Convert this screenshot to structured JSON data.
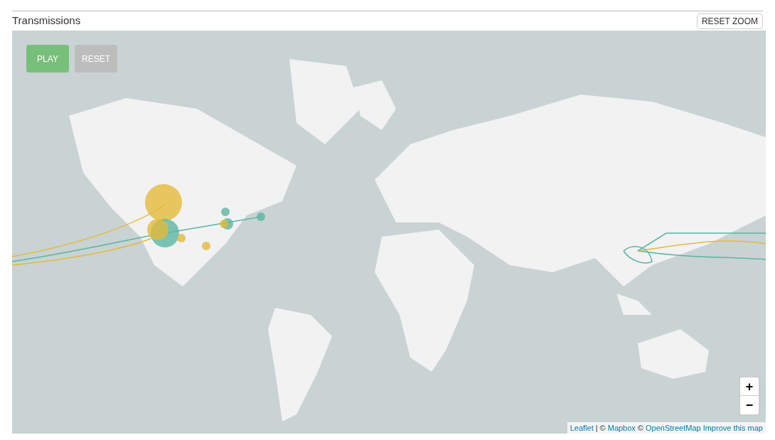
{
  "panel": {
    "title": "Transmissions",
    "reset_zoom_button": "RESET ZOOM"
  },
  "map": {
    "controls": [
      {
        "label": "PLAY",
        "kind": "play"
      },
      {
        "label": "RESET",
        "kind": "reset"
      }
    ],
    "zoom_buttons": [
      "+",
      "−"
    ],
    "attribution": [
      {
        "text": "Leaflet",
        "kind": "link"
      },
      {
        "text": "| ©",
        "kind": "text"
      },
      {
        "text": "Mapbox",
        "kind": "link"
      },
      {
        "text": "©",
        "kind": "text"
      },
      {
        "text": "OpenStreetMap",
        "kind": "link"
      },
      {
        "text": "Improve this map",
        "kind": "link"
      }
    ]
  }
}
